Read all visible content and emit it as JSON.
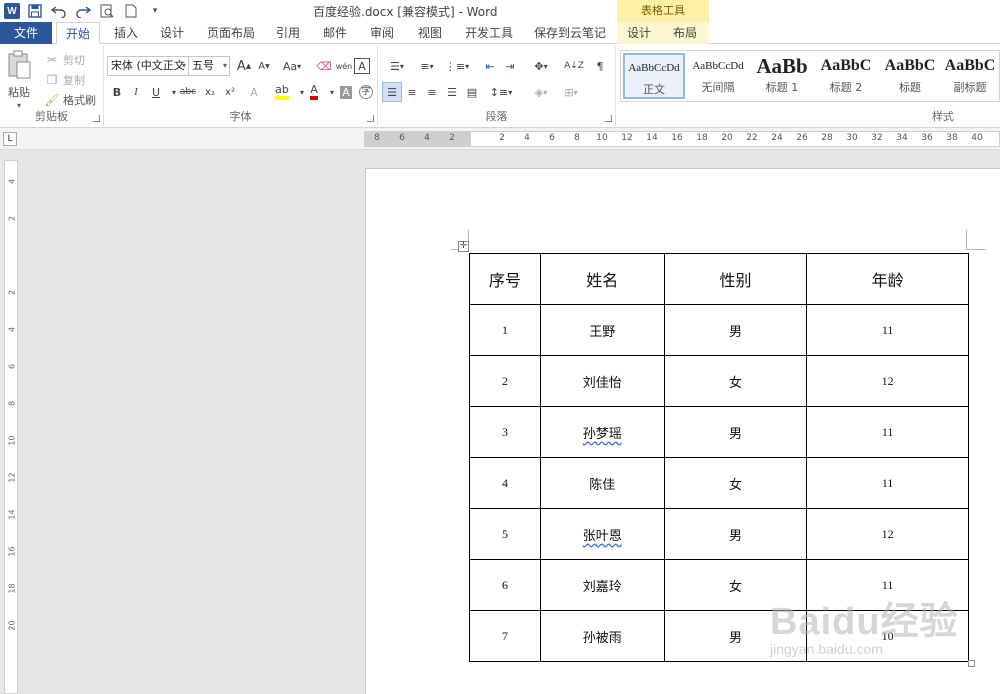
{
  "titlebar": {
    "doc_title": "百度经验.docx [兼容模式] - Word",
    "context_header": "表格工具",
    "word_logo": "W"
  },
  "tabs": {
    "file": "文件",
    "items": [
      "开始",
      "插入",
      "设计",
      "页面布局",
      "引用",
      "邮件",
      "审阅",
      "视图",
      "开发工具",
      "保存到云笔记"
    ],
    "context_items": [
      "设计",
      "布局"
    ],
    "active": "开始"
  },
  "clipboard": {
    "paste": "粘贴",
    "cut": "剪切",
    "copy": "复制",
    "format_painter": "格式刷",
    "label": "剪贴板"
  },
  "font": {
    "font_name": "宋体 (中文正文",
    "font_size": "五号",
    "grow": "A",
    "shrink": "A",
    "change_case": "Aa",
    "phonetic": "wén",
    "border_char": "A",
    "bold": "B",
    "italic": "I",
    "underline": "U",
    "strike": "abc",
    "subscript": "x₂",
    "superscript": "x²",
    "label": "字体"
  },
  "paragraph": {
    "label": "段落"
  },
  "styles": {
    "label": "样式",
    "items": [
      {
        "preview": "AaBbCcDd",
        "name": "正文"
      },
      {
        "preview": "AaBbCcDd",
        "name": "无间隔"
      },
      {
        "preview": "AaBb",
        "name": "标题 1"
      },
      {
        "preview": "AaBbC",
        "name": "标题 2"
      },
      {
        "preview": "AaBbC",
        "name": "标题"
      },
      {
        "preview": "AaBbC",
        "name": "副标题"
      }
    ]
  },
  "ruler": {
    "numbers": [
      "8",
      "6",
      "4",
      "2",
      "",
      "2",
      "4",
      "6",
      "8",
      "10",
      "12",
      "14",
      "16",
      "18",
      "20",
      "22",
      "24",
      "26",
      "28",
      "30",
      "32",
      "34",
      "36",
      "38",
      "40"
    ]
  },
  "vruler": {
    "numbers": [
      "4",
      "2",
      "",
      "2",
      "4",
      "6",
      "8",
      "10",
      "12",
      "14",
      "16",
      "18",
      "20"
    ]
  },
  "table": {
    "headers": [
      "序号",
      "姓名",
      "性别",
      "年龄"
    ],
    "rows": [
      [
        "1",
        "王野",
        "男",
        "11"
      ],
      [
        "2",
        "刘佳怡",
        "女",
        "12"
      ],
      [
        "3",
        "孙梦瑶",
        "男",
        "11"
      ],
      [
        "4",
        "陈佳",
        "女",
        "11"
      ],
      [
        "5",
        "张叶恩",
        "男",
        "12"
      ],
      [
        "6",
        "刘嘉玲",
        "女",
        "11"
      ],
      [
        "7",
        "孙被雨",
        "男",
        "10"
      ]
    ]
  },
  "watermark": {
    "logo": "Baidu经验",
    "url": "jingyan.baidu.com"
  }
}
